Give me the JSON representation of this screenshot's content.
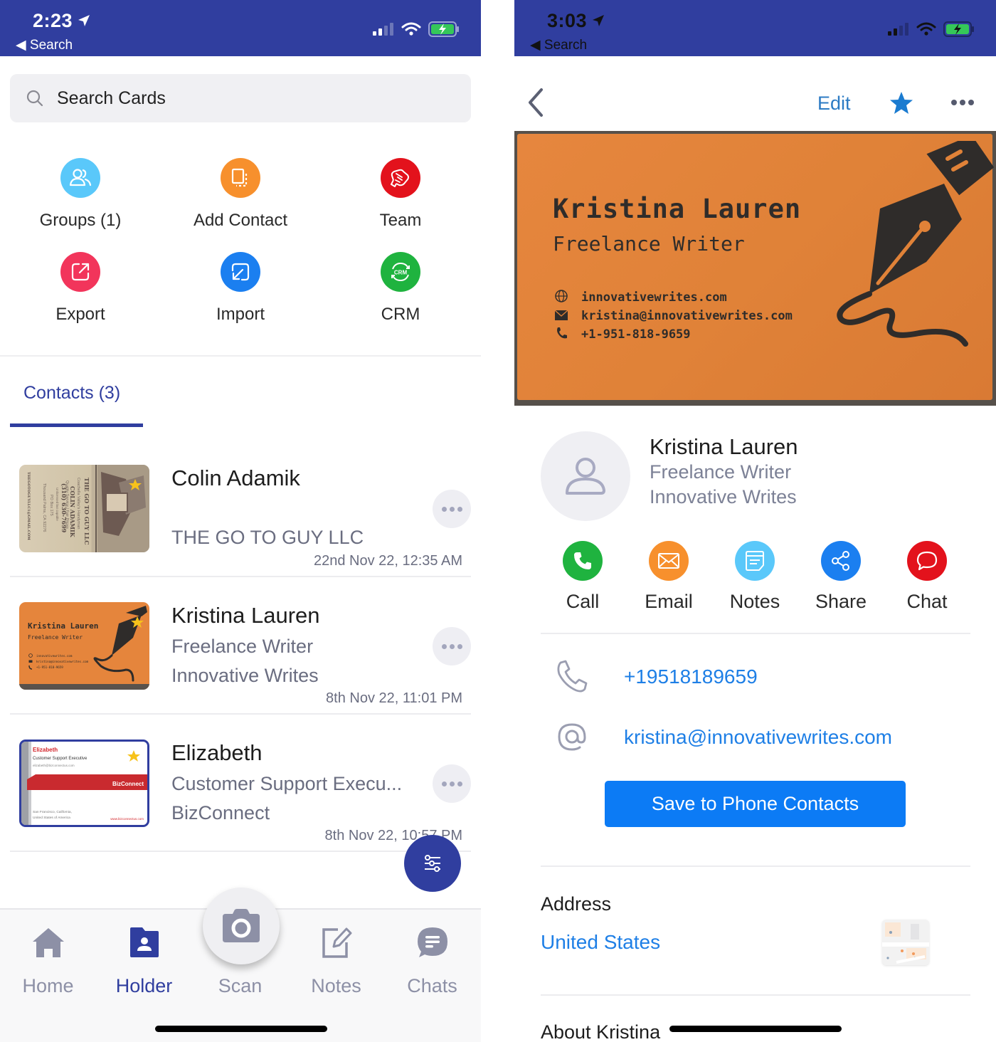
{
  "left": {
    "status_bar": {
      "time": "2:23",
      "back_label": "Search",
      "bg_color": "#303e9f"
    },
    "search": {
      "placeholder": "Search Cards",
      "value": ""
    },
    "quick_actions": [
      {
        "label": "Groups (1)",
        "icon": "groups-icon",
        "color": "#5ac8fa"
      },
      {
        "label": "Add Contact",
        "icon": "add-contact-icon",
        "color": "#f7902d"
      },
      {
        "label": "Team",
        "icon": "handshake-icon",
        "color": "#e3121c"
      },
      {
        "label": "Export",
        "icon": "export-icon",
        "color": "#f2355b"
      },
      {
        "label": "Import",
        "icon": "import-icon",
        "color": "#1b7ff0"
      },
      {
        "label": "CRM",
        "icon": "crm-sync-icon",
        "color": "#1fb33f",
        "badge": "CRM"
      }
    ],
    "tab": {
      "label": "Contacts (3)"
    },
    "contacts": [
      {
        "name": "Colin Adamik",
        "title": "",
        "company": "THE GO TO GUY LLC",
        "date": "22nd Nov 22, 12:35 AM",
        "card": {
          "company": "THE GO TO GUY LLC",
          "tagline": "Coachella Valley's Handyman",
          "name": "COLIN ADAMIK",
          "line1": "Quality Service / Fair Prices",
          "phone": "(310) 630-7699",
          "line2": "Unlicensed but capable",
          "address1": "PO Box 175",
          "address2": "Thousand Palms, CA 92276",
          "email": "THEGOTOGUYLLC1@GMAIL.COM"
        }
      },
      {
        "name": "Kristina Lauren",
        "title": "Freelance Writer",
        "company": "Innovative Writes",
        "date": "8th Nov 22, 11:01 PM",
        "card": {
          "name": "Kristina Lauren",
          "title": "Freelance Writer",
          "website": "innovativewrites.com",
          "email": "kristina@innovativewrites.com",
          "phone": "+1-951-818-9659"
        }
      },
      {
        "name": "Elizabeth",
        "title": "Customer Support Execu...",
        "company": "BizConnect",
        "date": "8th Nov 22, 10:57 PM",
        "card": {
          "name": "Elizabeth",
          "title": "Customer Support Executive",
          "email": "elizabeth@bizconnectus.com",
          "brand": "BizConnect",
          "address1": "San Francisco, California,",
          "address2": "United States of America",
          "website": "www.bizconnectus.com"
        }
      }
    ],
    "bottom_nav": [
      {
        "label": "Home",
        "icon": "home-icon",
        "active": false
      },
      {
        "label": "Holder",
        "icon": "holder-icon",
        "active": true
      },
      {
        "label": "Scan",
        "icon": "camera-icon",
        "active": false
      },
      {
        "label": "Notes",
        "icon": "notes-icon",
        "active": false
      },
      {
        "label": "Chats",
        "icon": "chats-icon",
        "active": false
      }
    ]
  },
  "right": {
    "status_bar": {
      "time": "3:03",
      "back_label": "Search"
    },
    "toolbar": {
      "edit_label": "Edit"
    },
    "business_card": {
      "name": "Kristina Lauren",
      "title": "Freelance Writer",
      "website": "innovativewrites.com",
      "email": "kristina@innovativewrites.com",
      "phone": "+1-951-818-9659"
    },
    "profile": {
      "name": "Kristina Lauren",
      "title": "Freelance Writer",
      "company": "Innovative Writes"
    },
    "actions": [
      {
        "label": "Call",
        "icon": "phone-icon",
        "color": "#1fb33f"
      },
      {
        "label": "Email",
        "icon": "envelope-icon",
        "color": "#f7902d"
      },
      {
        "label": "Notes",
        "icon": "note-icon",
        "color": "#5ac8fa"
      },
      {
        "label": "Share",
        "icon": "share-icon",
        "color": "#1b7ff0"
      },
      {
        "label": "Chat",
        "icon": "chat-bubble-icon",
        "color": "#e3121c"
      }
    ],
    "phone": "+19518189659",
    "email": "kristina@innovativewrites.com",
    "save_button_label": "Save to Phone Contacts",
    "address": {
      "heading": "Address",
      "value": "United States"
    },
    "about_heading": "About Kristina"
  }
}
